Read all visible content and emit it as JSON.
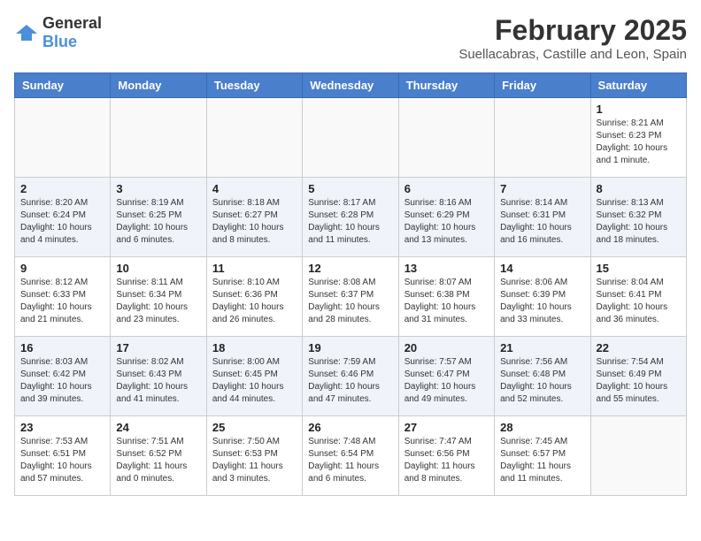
{
  "logo": {
    "general": "General",
    "blue": "Blue"
  },
  "title": "February 2025",
  "subtitle": "Suellacabras, Castille and Leon, Spain",
  "weekdays": [
    "Sunday",
    "Monday",
    "Tuesday",
    "Wednesday",
    "Thursday",
    "Friday",
    "Saturday"
  ],
  "weeks": [
    {
      "alt": false,
      "days": [
        {
          "num": "",
          "info": ""
        },
        {
          "num": "",
          "info": ""
        },
        {
          "num": "",
          "info": ""
        },
        {
          "num": "",
          "info": ""
        },
        {
          "num": "",
          "info": ""
        },
        {
          "num": "",
          "info": ""
        },
        {
          "num": "1",
          "info": "Sunrise: 8:21 AM\nSunset: 6:23 PM\nDaylight: 10 hours\nand 1 minute."
        }
      ]
    },
    {
      "alt": true,
      "days": [
        {
          "num": "2",
          "info": "Sunrise: 8:20 AM\nSunset: 6:24 PM\nDaylight: 10 hours\nand 4 minutes."
        },
        {
          "num": "3",
          "info": "Sunrise: 8:19 AM\nSunset: 6:25 PM\nDaylight: 10 hours\nand 6 minutes."
        },
        {
          "num": "4",
          "info": "Sunrise: 8:18 AM\nSunset: 6:27 PM\nDaylight: 10 hours\nand 8 minutes."
        },
        {
          "num": "5",
          "info": "Sunrise: 8:17 AM\nSunset: 6:28 PM\nDaylight: 10 hours\nand 11 minutes."
        },
        {
          "num": "6",
          "info": "Sunrise: 8:16 AM\nSunset: 6:29 PM\nDaylight: 10 hours\nand 13 minutes."
        },
        {
          "num": "7",
          "info": "Sunrise: 8:14 AM\nSunset: 6:31 PM\nDaylight: 10 hours\nand 16 minutes."
        },
        {
          "num": "8",
          "info": "Sunrise: 8:13 AM\nSunset: 6:32 PM\nDaylight: 10 hours\nand 18 minutes."
        }
      ]
    },
    {
      "alt": false,
      "days": [
        {
          "num": "9",
          "info": "Sunrise: 8:12 AM\nSunset: 6:33 PM\nDaylight: 10 hours\nand 21 minutes."
        },
        {
          "num": "10",
          "info": "Sunrise: 8:11 AM\nSunset: 6:34 PM\nDaylight: 10 hours\nand 23 minutes."
        },
        {
          "num": "11",
          "info": "Sunrise: 8:10 AM\nSunset: 6:36 PM\nDaylight: 10 hours\nand 26 minutes."
        },
        {
          "num": "12",
          "info": "Sunrise: 8:08 AM\nSunset: 6:37 PM\nDaylight: 10 hours\nand 28 minutes."
        },
        {
          "num": "13",
          "info": "Sunrise: 8:07 AM\nSunset: 6:38 PM\nDaylight: 10 hours\nand 31 minutes."
        },
        {
          "num": "14",
          "info": "Sunrise: 8:06 AM\nSunset: 6:39 PM\nDaylight: 10 hours\nand 33 minutes."
        },
        {
          "num": "15",
          "info": "Sunrise: 8:04 AM\nSunset: 6:41 PM\nDaylight: 10 hours\nand 36 minutes."
        }
      ]
    },
    {
      "alt": true,
      "days": [
        {
          "num": "16",
          "info": "Sunrise: 8:03 AM\nSunset: 6:42 PM\nDaylight: 10 hours\nand 39 minutes."
        },
        {
          "num": "17",
          "info": "Sunrise: 8:02 AM\nSunset: 6:43 PM\nDaylight: 10 hours\nand 41 minutes."
        },
        {
          "num": "18",
          "info": "Sunrise: 8:00 AM\nSunset: 6:45 PM\nDaylight: 10 hours\nand 44 minutes."
        },
        {
          "num": "19",
          "info": "Sunrise: 7:59 AM\nSunset: 6:46 PM\nDaylight: 10 hours\nand 47 minutes."
        },
        {
          "num": "20",
          "info": "Sunrise: 7:57 AM\nSunset: 6:47 PM\nDaylight: 10 hours\nand 49 minutes."
        },
        {
          "num": "21",
          "info": "Sunrise: 7:56 AM\nSunset: 6:48 PM\nDaylight: 10 hours\nand 52 minutes."
        },
        {
          "num": "22",
          "info": "Sunrise: 7:54 AM\nSunset: 6:49 PM\nDaylight: 10 hours\nand 55 minutes."
        }
      ]
    },
    {
      "alt": false,
      "days": [
        {
          "num": "23",
          "info": "Sunrise: 7:53 AM\nSunset: 6:51 PM\nDaylight: 10 hours\nand 57 minutes."
        },
        {
          "num": "24",
          "info": "Sunrise: 7:51 AM\nSunset: 6:52 PM\nDaylight: 11 hours\nand 0 minutes."
        },
        {
          "num": "25",
          "info": "Sunrise: 7:50 AM\nSunset: 6:53 PM\nDaylight: 11 hours\nand 3 minutes."
        },
        {
          "num": "26",
          "info": "Sunrise: 7:48 AM\nSunset: 6:54 PM\nDaylight: 11 hours\nand 6 minutes."
        },
        {
          "num": "27",
          "info": "Sunrise: 7:47 AM\nSunset: 6:56 PM\nDaylight: 11 hours\nand 8 minutes."
        },
        {
          "num": "28",
          "info": "Sunrise: 7:45 AM\nSunset: 6:57 PM\nDaylight: 11 hours\nand 11 minutes."
        },
        {
          "num": "",
          "info": ""
        }
      ]
    }
  ]
}
